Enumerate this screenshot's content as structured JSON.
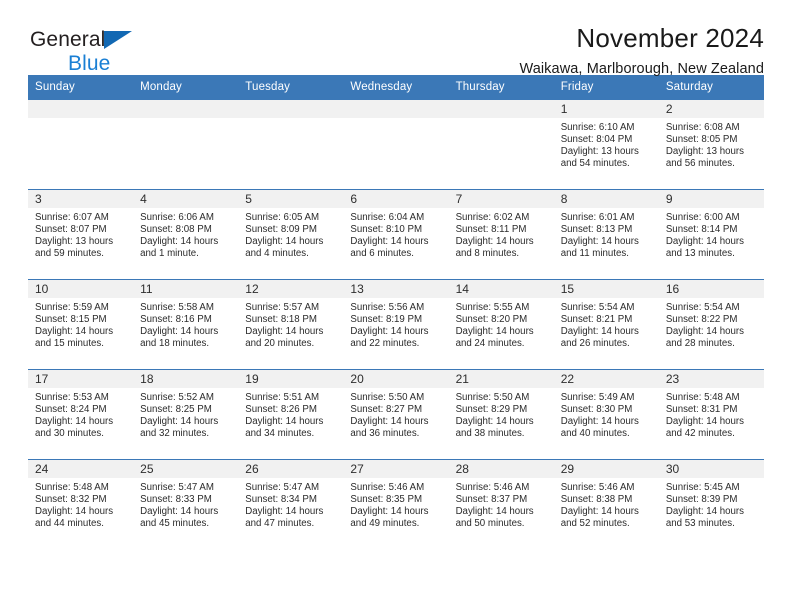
{
  "brand": {
    "line1": "General",
    "line2": "Blue",
    "triangle_color": "#1268b3",
    "text_color": "#231f20",
    "accent_color": "#1a7fd4"
  },
  "header": {
    "title": "November 2024",
    "subtitle": "Waikawa, Marlborough, New Zealand"
  },
  "theme": {
    "header_bg": "#3b78b7",
    "header_text": "#ffffff",
    "daynum_bg": "#f1f1f1",
    "grid_line": "#3b78b7",
    "body_text": "#2b2b2b"
  },
  "weekday_headers": [
    "Sunday",
    "Monday",
    "Tuesday",
    "Wednesday",
    "Thursday",
    "Friday",
    "Saturday"
  ],
  "weeks": [
    [
      {
        "day": "",
        "sunrise": "",
        "sunset": "",
        "daylight_line1": "",
        "daylight_line2": ""
      },
      {
        "day": "",
        "sunrise": "",
        "sunset": "",
        "daylight_line1": "",
        "daylight_line2": ""
      },
      {
        "day": "",
        "sunrise": "",
        "sunset": "",
        "daylight_line1": "",
        "daylight_line2": ""
      },
      {
        "day": "",
        "sunrise": "",
        "sunset": "",
        "daylight_line1": "",
        "daylight_line2": ""
      },
      {
        "day": "",
        "sunrise": "",
        "sunset": "",
        "daylight_line1": "",
        "daylight_line2": ""
      },
      {
        "day": "1",
        "sunrise": "Sunrise: 6:10 AM",
        "sunset": "Sunset: 8:04 PM",
        "daylight_line1": "Daylight: 13 hours",
        "daylight_line2": "and 54 minutes."
      },
      {
        "day": "2",
        "sunrise": "Sunrise: 6:08 AM",
        "sunset": "Sunset: 8:05 PM",
        "daylight_line1": "Daylight: 13 hours",
        "daylight_line2": "and 56 minutes."
      }
    ],
    [
      {
        "day": "3",
        "sunrise": "Sunrise: 6:07 AM",
        "sunset": "Sunset: 8:07 PM",
        "daylight_line1": "Daylight: 13 hours",
        "daylight_line2": "and 59 minutes."
      },
      {
        "day": "4",
        "sunrise": "Sunrise: 6:06 AM",
        "sunset": "Sunset: 8:08 PM",
        "daylight_line1": "Daylight: 14 hours",
        "daylight_line2": "and 1 minute."
      },
      {
        "day": "5",
        "sunrise": "Sunrise: 6:05 AM",
        "sunset": "Sunset: 8:09 PM",
        "daylight_line1": "Daylight: 14 hours",
        "daylight_line2": "and 4 minutes."
      },
      {
        "day": "6",
        "sunrise": "Sunrise: 6:04 AM",
        "sunset": "Sunset: 8:10 PM",
        "daylight_line1": "Daylight: 14 hours",
        "daylight_line2": "and 6 minutes."
      },
      {
        "day": "7",
        "sunrise": "Sunrise: 6:02 AM",
        "sunset": "Sunset: 8:11 PM",
        "daylight_line1": "Daylight: 14 hours",
        "daylight_line2": "and 8 minutes."
      },
      {
        "day": "8",
        "sunrise": "Sunrise: 6:01 AM",
        "sunset": "Sunset: 8:13 PM",
        "daylight_line1": "Daylight: 14 hours",
        "daylight_line2": "and 11 minutes."
      },
      {
        "day": "9",
        "sunrise": "Sunrise: 6:00 AM",
        "sunset": "Sunset: 8:14 PM",
        "daylight_line1": "Daylight: 14 hours",
        "daylight_line2": "and 13 minutes."
      }
    ],
    [
      {
        "day": "10",
        "sunrise": "Sunrise: 5:59 AM",
        "sunset": "Sunset: 8:15 PM",
        "daylight_line1": "Daylight: 14 hours",
        "daylight_line2": "and 15 minutes."
      },
      {
        "day": "11",
        "sunrise": "Sunrise: 5:58 AM",
        "sunset": "Sunset: 8:16 PM",
        "daylight_line1": "Daylight: 14 hours",
        "daylight_line2": "and 18 minutes."
      },
      {
        "day": "12",
        "sunrise": "Sunrise: 5:57 AM",
        "sunset": "Sunset: 8:18 PM",
        "daylight_line1": "Daylight: 14 hours",
        "daylight_line2": "and 20 minutes."
      },
      {
        "day": "13",
        "sunrise": "Sunrise: 5:56 AM",
        "sunset": "Sunset: 8:19 PM",
        "daylight_line1": "Daylight: 14 hours",
        "daylight_line2": "and 22 minutes."
      },
      {
        "day": "14",
        "sunrise": "Sunrise: 5:55 AM",
        "sunset": "Sunset: 8:20 PM",
        "daylight_line1": "Daylight: 14 hours",
        "daylight_line2": "and 24 minutes."
      },
      {
        "day": "15",
        "sunrise": "Sunrise: 5:54 AM",
        "sunset": "Sunset: 8:21 PM",
        "daylight_line1": "Daylight: 14 hours",
        "daylight_line2": "and 26 minutes."
      },
      {
        "day": "16",
        "sunrise": "Sunrise: 5:54 AM",
        "sunset": "Sunset: 8:22 PM",
        "daylight_line1": "Daylight: 14 hours",
        "daylight_line2": "and 28 minutes."
      }
    ],
    [
      {
        "day": "17",
        "sunrise": "Sunrise: 5:53 AM",
        "sunset": "Sunset: 8:24 PM",
        "daylight_line1": "Daylight: 14 hours",
        "daylight_line2": "and 30 minutes."
      },
      {
        "day": "18",
        "sunrise": "Sunrise: 5:52 AM",
        "sunset": "Sunset: 8:25 PM",
        "daylight_line1": "Daylight: 14 hours",
        "daylight_line2": "and 32 minutes."
      },
      {
        "day": "19",
        "sunrise": "Sunrise: 5:51 AM",
        "sunset": "Sunset: 8:26 PM",
        "daylight_line1": "Daylight: 14 hours",
        "daylight_line2": "and 34 minutes."
      },
      {
        "day": "20",
        "sunrise": "Sunrise: 5:50 AM",
        "sunset": "Sunset: 8:27 PM",
        "daylight_line1": "Daylight: 14 hours",
        "daylight_line2": "and 36 minutes."
      },
      {
        "day": "21",
        "sunrise": "Sunrise: 5:50 AM",
        "sunset": "Sunset: 8:29 PM",
        "daylight_line1": "Daylight: 14 hours",
        "daylight_line2": "and 38 minutes."
      },
      {
        "day": "22",
        "sunrise": "Sunrise: 5:49 AM",
        "sunset": "Sunset: 8:30 PM",
        "daylight_line1": "Daylight: 14 hours",
        "daylight_line2": "and 40 minutes."
      },
      {
        "day": "23",
        "sunrise": "Sunrise: 5:48 AM",
        "sunset": "Sunset: 8:31 PM",
        "daylight_line1": "Daylight: 14 hours",
        "daylight_line2": "and 42 minutes."
      }
    ],
    [
      {
        "day": "24",
        "sunrise": "Sunrise: 5:48 AM",
        "sunset": "Sunset: 8:32 PM",
        "daylight_line1": "Daylight: 14 hours",
        "daylight_line2": "and 44 minutes."
      },
      {
        "day": "25",
        "sunrise": "Sunrise: 5:47 AM",
        "sunset": "Sunset: 8:33 PM",
        "daylight_line1": "Daylight: 14 hours",
        "daylight_line2": "and 45 minutes."
      },
      {
        "day": "26",
        "sunrise": "Sunrise: 5:47 AM",
        "sunset": "Sunset: 8:34 PM",
        "daylight_line1": "Daylight: 14 hours",
        "daylight_line2": "and 47 minutes."
      },
      {
        "day": "27",
        "sunrise": "Sunrise: 5:46 AM",
        "sunset": "Sunset: 8:35 PM",
        "daylight_line1": "Daylight: 14 hours",
        "daylight_line2": "and 49 minutes."
      },
      {
        "day": "28",
        "sunrise": "Sunrise: 5:46 AM",
        "sunset": "Sunset: 8:37 PM",
        "daylight_line1": "Daylight: 14 hours",
        "daylight_line2": "and 50 minutes."
      },
      {
        "day": "29",
        "sunrise": "Sunrise: 5:46 AM",
        "sunset": "Sunset: 8:38 PM",
        "daylight_line1": "Daylight: 14 hours",
        "daylight_line2": "and 52 minutes."
      },
      {
        "day": "30",
        "sunrise": "Sunrise: 5:45 AM",
        "sunset": "Sunset: 8:39 PM",
        "daylight_line1": "Daylight: 14 hours",
        "daylight_line2": "and 53 minutes."
      }
    ]
  ]
}
